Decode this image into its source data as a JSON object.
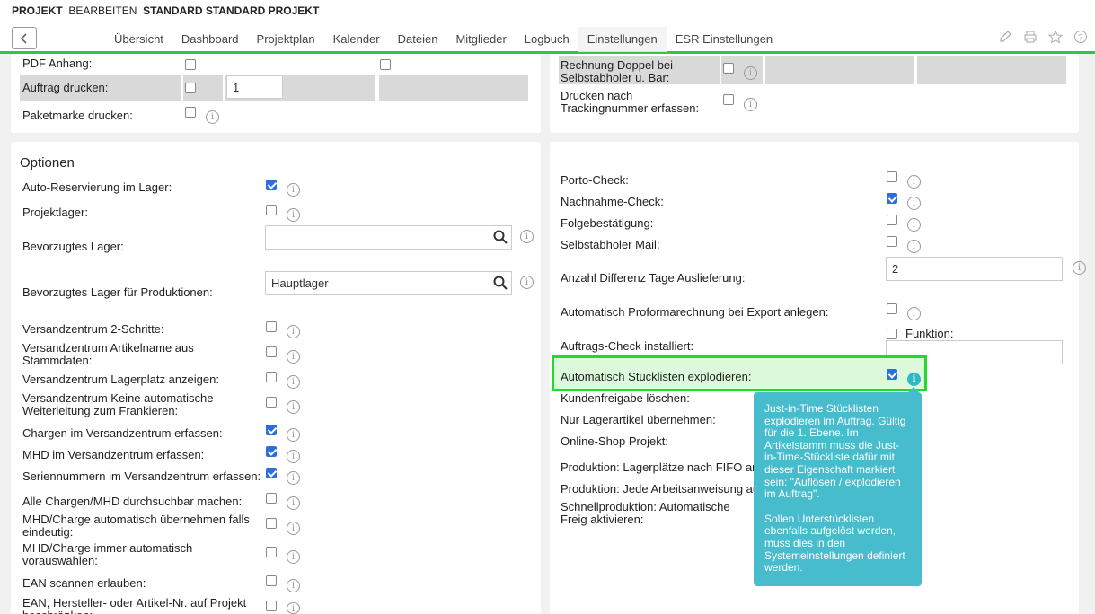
{
  "header": {
    "crumb_1": "PROJEKT",
    "crumb_2": "BEARBEITEN",
    "crumb_3": "STANDARD STANDARD PROJEKT",
    "tabs": [
      "Übersicht",
      "Dashboard",
      "Projektplan",
      "Kalender",
      "Dateien",
      "Mitglieder",
      "Logbuch",
      "Einstellungen",
      "ESR Einstellungen"
    ],
    "active_tab": "Einstellungen"
  },
  "top_left": {
    "pdf_anhang": "PDF Anhang:",
    "auftrag_drucken": "Auftrag drucken:",
    "auftrag_drucken_value": "1",
    "paketmarke": "Paketmarke drucken:"
  },
  "top_right": {
    "rechnung_doppel": "Rechnung Doppel bei Selbstabholer u. Bar:",
    "drucken_tracking": "Drucken nach Trackingnummer erfassen:"
  },
  "optionen": {
    "title": "Optionen",
    "auto_reservierung": "Auto-Reservierung im Lager:",
    "projektlager": "Projektlager:",
    "bevorzugtes_lager": "Bevorzugtes Lager:",
    "bevorzugtes_lager_value": "",
    "bevorzugtes_lager_prod": "Bevorzugtes Lager für Produktionen:",
    "bevorzugtes_lager_prod_value": "Hauptlager",
    "vz_2schritte": "Versandzentrum 2-Schritte:",
    "vz_artikelname": "Versandzentrum Artikelname aus Stammdaten:",
    "vz_lagerplatz": "Versandzentrum Lagerplatz anzeigen:",
    "vz_keine_weiterleitung": "Versandzentrum Keine automatische Weiterleitung zum Frankieren:",
    "chargen_vz": "Chargen im Versandzentrum erfassen:",
    "mhd_vz": "MHD im Versandzentrum erfassen:",
    "seriennummern_vz": "Seriennummern im Versandzentrum erfassen:",
    "alle_chargen": "Alle Chargen/MHD durchsuchbar machen:",
    "mhd_auto_eindeutig": "MHD/Charge automatisch übernehmen falls eindeutig:",
    "mhd_immer_auto": "MHD/Charge immer automatisch vorauswählen:",
    "ean_scannen": "EAN scannen erlauben:",
    "ean_hersteller": "EAN, Hersteller- oder Artikel-Nr. auf Projekt beschränken:"
  },
  "right_options": {
    "porto_check": "Porto-Check:",
    "nachnahme_check": "Nachnahme-Check:",
    "folgebestaetigung": "Folgebestätigung:",
    "selbstabholer_mail": "Selbstabholer Mail:",
    "anzahl_differenz": "Anzahl Differenz Tage Auslieferung:",
    "anzahl_differenz_value": "2",
    "proforma": "Automatisch Proformarechnung bei Export anlegen:",
    "funktion": "Funktion:",
    "auftrags_check": "Auftrags-Check installiert:",
    "stuecklisten": "Automatisch Stücklisten explodieren:",
    "kundenfreigabe": "Kundenfreigabe löschen:",
    "nur_lagerartikel": "Nur Lagerartikel übernehmen:",
    "online_shop": "Online-Shop Projekt:",
    "produktion_fifo": "Produktion: Lagerplätze nach FIFO an:",
    "produktion_arbeitsanweisung": "Produktion: Jede Arbeitsanweisung au",
    "schnellproduktion": "Schnellproduktion: Automatische Freig aktivieren:"
  },
  "tooltip": {
    "p1": "Just-in-Time Stücklisten explodieren im Auftrag. Gültig für die 1. Ebene. Im Artikelstamm muss die Just-in-Time-Stückliste dafür mit dieser Eigenschaft markiert sein: \"Auflösen / explodieren im Auftrag\".",
    "p2": "Sollen Unterstücklisten ebenfalls aufgelöst werden, muss dies in den Systemeinstellungen definiert werden."
  },
  "colors": {
    "accent": "#38c24a",
    "highlight_border": "#1fdc2a",
    "tooltip_bg": "#47bccd",
    "checkbox": "#2a6fdb"
  },
  "icons": [
    "back-arrow-icon",
    "pencil-icon",
    "printer-icon",
    "star-icon",
    "help-icon",
    "search-icon",
    "info-icon"
  ]
}
